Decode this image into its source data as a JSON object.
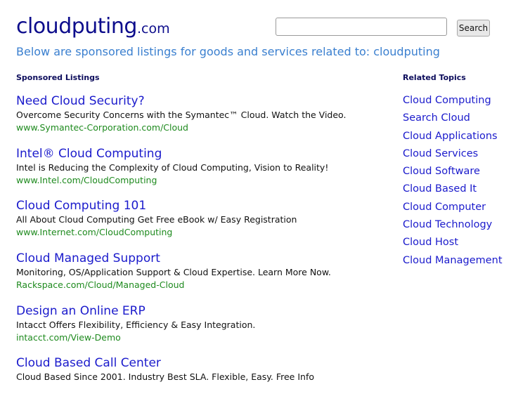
{
  "site": {
    "name": "cloudputing",
    "tld": ".com"
  },
  "search": {
    "placeholder": "",
    "button_label": "Search"
  },
  "tagline": "Below are sponsored listings for goods and services related to: cloudputing",
  "sponsored": {
    "heading": "Sponsored Listings",
    "listings": [
      {
        "title": "Need Cloud Security?",
        "description": "Overcome Security Concerns with the Symantec™ Cloud. Watch the Video.",
        "url": "www.Symantec-Corporation.com/Cloud"
      },
      {
        "title": "Intel® Cloud Computing",
        "description": "Intel is Reducing the Complexity of Cloud Computing, Vision to Reality!",
        "url": "www.Intel.com/CloudComputing"
      },
      {
        "title": "Cloud Computing 101",
        "description": "All About Cloud Computing Get Free eBook w/ Easy Registration",
        "url": "www.Internet.com/CloudComputing"
      },
      {
        "title": "Cloud Managed Support",
        "description": "Monitoring, OS/Application Support & Cloud Expertise. Learn More Now.",
        "url": "Rackspace.com/Cloud/Managed-Cloud"
      },
      {
        "title": "Design an Online ERP",
        "description": "Intacct Offers Flexibility, Efficiency & Easy Integration.",
        "url": "intacct.com/View-Demo"
      },
      {
        "title": "Cloud Based Call Center",
        "description": "Cloud Based Since 2001. Industry Best SLA. Flexible, Easy. Free Info",
        "url": ""
      }
    ]
  },
  "related": {
    "heading": "Related Topics",
    "items": [
      "Cloud Computing",
      "Search Cloud",
      "Cloud Applications",
      "Cloud Services",
      "Cloud Software",
      "Cloud Based It",
      "Cloud Computer",
      "Cloud Technology",
      "Cloud Host",
      "Cloud Management"
    ]
  }
}
